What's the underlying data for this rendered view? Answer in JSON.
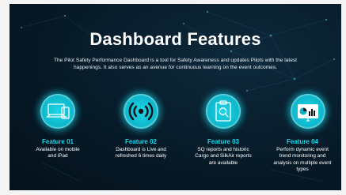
{
  "page": {
    "title": "Dashboard Features",
    "subtitle_line1": "The Pilot Safety Performance Dashboard is a tool for Safety Awareness and updates Pilots with the latest",
    "subtitle_line2": "happenings. It also serves as an avenue for continuous learning on the event outcomes."
  },
  "colors": {
    "background": "#071a28",
    "accent": "#19d8ea",
    "title_text": "#ffffff"
  },
  "features": [
    {
      "title": "Feature 01",
      "icon": "devices-icon",
      "desc_lines": [
        "Available on mobile",
        "and iPad"
      ]
    },
    {
      "title": "Feature 02",
      "icon": "broadcast-icon",
      "desc_lines": [
        "Dashboard is Live and",
        "refreshed 6 times daily"
      ]
    },
    {
      "title": "Feature 03",
      "icon": "report-search-icon",
      "desc_lines": [
        "SQ reports and historic",
        "Cargo and SilkAir reports",
        "are available"
      ]
    },
    {
      "title": "Feature 04",
      "icon": "trend-analysis-icon",
      "desc_lines": [
        "Perform dynamic event",
        "trend monitoring and",
        "analysis on multiple event",
        "types"
      ]
    }
  ]
}
